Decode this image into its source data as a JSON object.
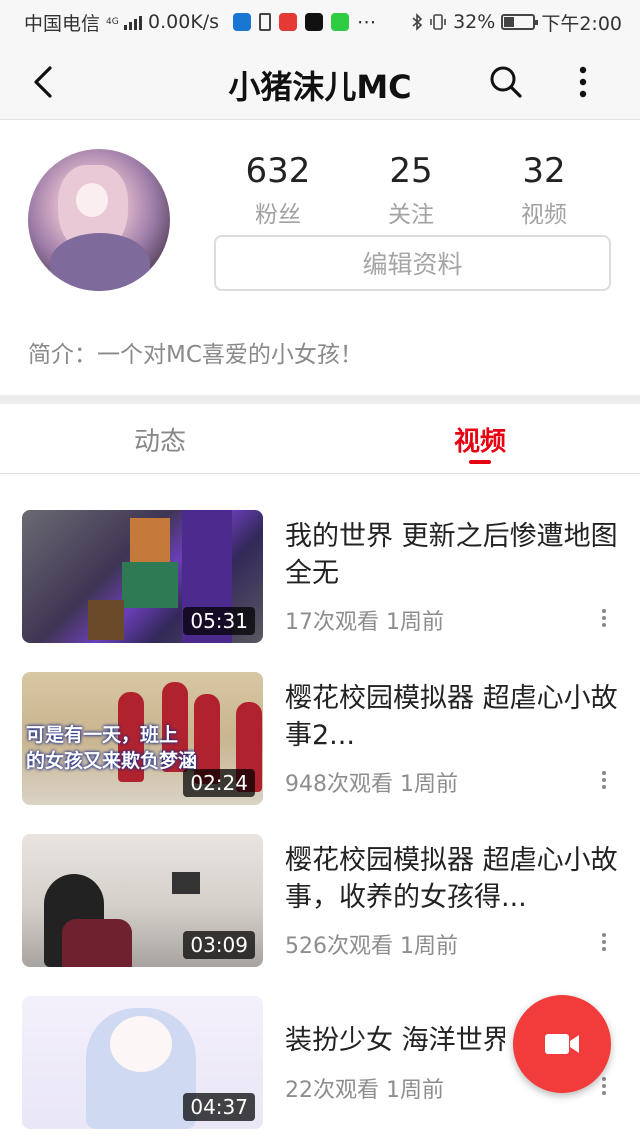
{
  "status_bar": {
    "carrier": "中国电信",
    "network": "4G",
    "speed": "0.00K/s",
    "battery": "32%",
    "battery_level": 0.32,
    "time": "下午2:00",
    "app_icons": [
      {
        "name": "shield-app-icon",
        "color": "#1976d2"
      },
      {
        "name": "hourglass-icon",
        "color": "#444444"
      },
      {
        "name": "toutiao-app-icon",
        "color": "#e53935"
      },
      {
        "name": "capcut-app-icon",
        "color": "#111111"
      },
      {
        "name": "iqiyi-app-icon",
        "color": "#2ecc40"
      }
    ]
  },
  "app_bar": {
    "title": "小猪沫儿MC",
    "back_icon": "chevron-left-icon",
    "search_icon": "search-icon",
    "more_icon": "more-vertical-icon"
  },
  "profile": {
    "stats": [
      {
        "value": "632",
        "label": "粉丝"
      },
      {
        "value": "25",
        "label": "关注"
      },
      {
        "value": "32",
        "label": "视频"
      }
    ],
    "edit_label": "编辑资料",
    "intro": "简介：一个对MC喜爱的小女孩！"
  },
  "tabs": [
    {
      "label": "动态",
      "active": false
    },
    {
      "label": "视频",
      "active": true
    }
  ],
  "videos": [
    {
      "title": "我的世界 更新之后惨遭地图全无",
      "views": "17次观看",
      "time": "1周前",
      "duration": "05:31"
    },
    {
      "title": "樱花校园模拟器 超虐心小故事2...",
      "views": "948次观看",
      "time": "1周前",
      "duration": "02:24",
      "caption_line1": "可是有一天，班上",
      "caption_line2": "的女孩又来欺负梦涵"
    },
    {
      "title": "樱花校园模拟器 超虐心小故事，收养的女孩得...",
      "views": "526次观看",
      "time": "1周前",
      "duration": "03:09"
    },
    {
      "title": "装扮少女 海洋世界",
      "views": "22次观看",
      "time": "1周前",
      "duration": "04:37"
    }
  ],
  "fab": {
    "icon": "video-camera-icon",
    "color": "#f23b3b"
  },
  "colors": {
    "accent": "#e60012",
    "muted": "#a2a2a2"
  }
}
